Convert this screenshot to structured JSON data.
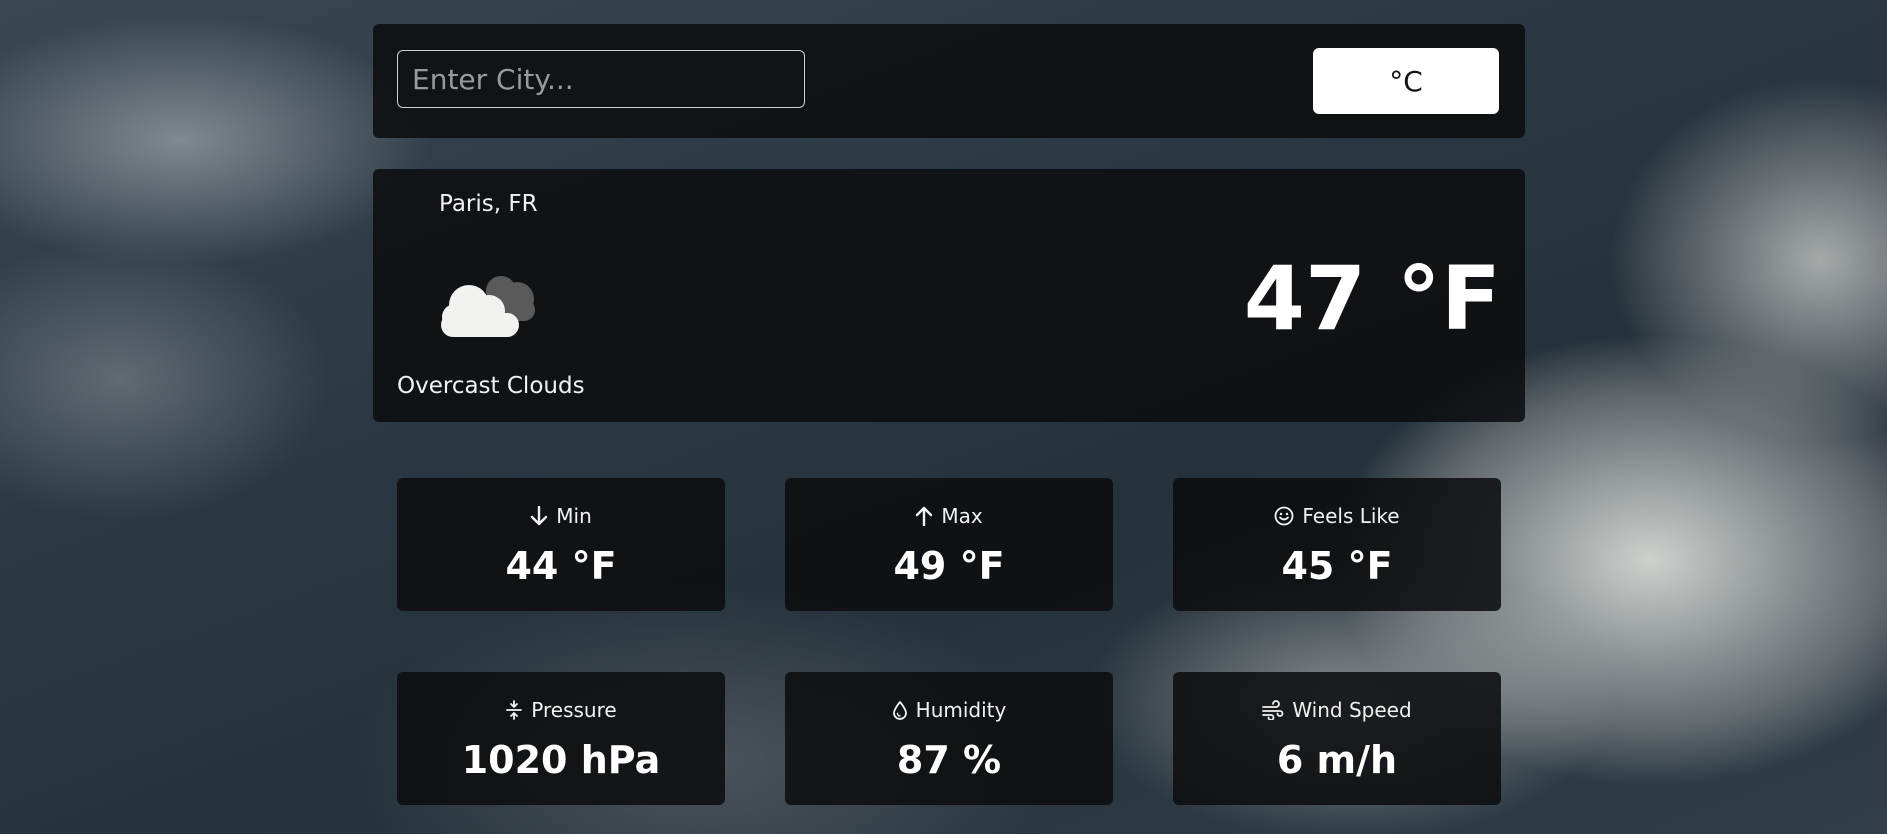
{
  "search": {
    "placeholder": "Enter City...",
    "value": ""
  },
  "unit_toggle": {
    "label": "°C"
  },
  "current": {
    "location": "Paris, FR",
    "icon": "overcast-clouds-icon",
    "condition": "Overcast Clouds",
    "temperature": "47 °F"
  },
  "stats": [
    {
      "icon": "arrow-down-icon",
      "label": "Min",
      "value": "44 °F"
    },
    {
      "icon": "arrow-up-icon",
      "label": "Max",
      "value": "49 °F"
    },
    {
      "icon": "smile-icon",
      "label": "Feels Like",
      "value": "45 °F"
    },
    {
      "icon": "pressure-icon",
      "label": "Pressure",
      "value": "1020 hPa"
    },
    {
      "icon": "droplet-icon",
      "label": "Humidity",
      "value": "87 %"
    },
    {
      "icon": "wind-icon",
      "label": "Wind Speed",
      "value": "6 m/h"
    }
  ],
  "colors": {
    "panel": "#0c0e10",
    "text": "#ffffff",
    "button_bg": "#ffffff"
  }
}
